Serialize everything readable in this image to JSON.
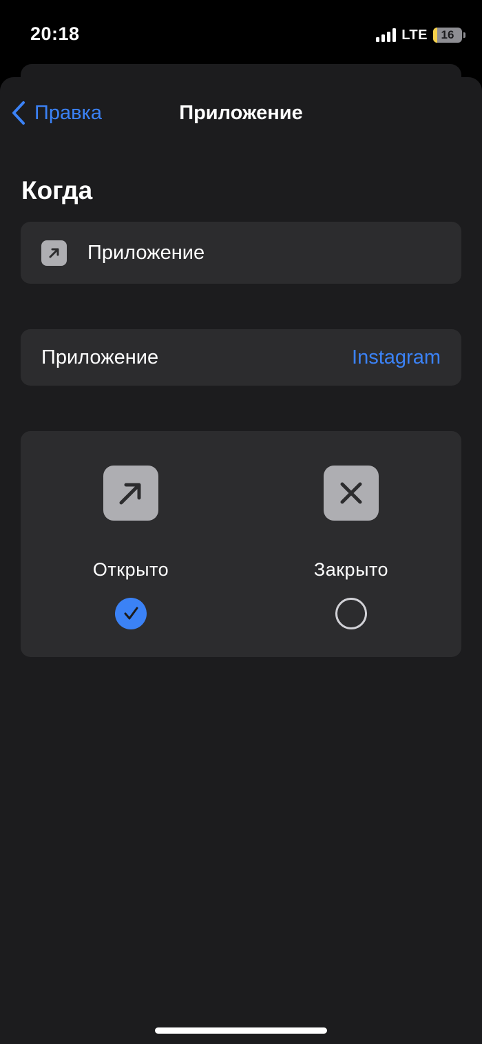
{
  "status_bar": {
    "time": "20:18",
    "network": "LTE",
    "battery": "16"
  },
  "nav": {
    "back_label": "Правка",
    "title": "Приложение"
  },
  "section": {
    "title": "Когда"
  },
  "trigger": {
    "label": "Приложение",
    "icon": "arrow-up-right-icon"
  },
  "app_row": {
    "label": "Приложение",
    "value": "Instagram"
  },
  "state_options": [
    {
      "label": "Открыто",
      "icon": "arrow-up-right-icon",
      "selected": true
    },
    {
      "label": "Закрыто",
      "icon": "xmark-icon",
      "selected": false
    }
  ],
  "colors": {
    "accent": "#3b82f6",
    "background": "#1c1c1e",
    "card": "#2c2c2e",
    "icon_tile": "#aeaeb2",
    "battery_low": "#f5d14b"
  }
}
